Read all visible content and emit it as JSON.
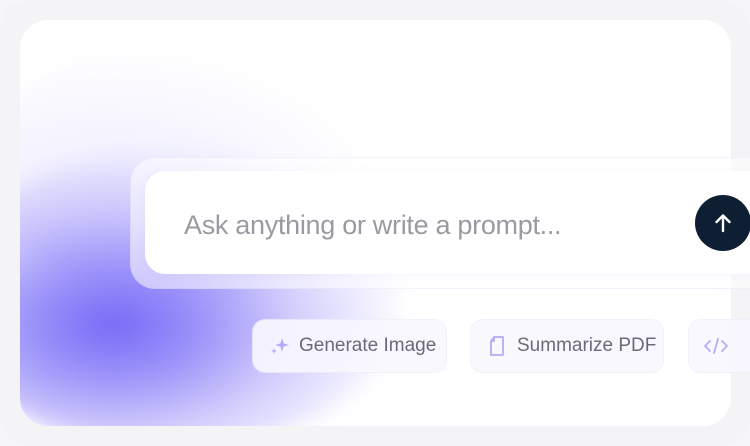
{
  "prompt": {
    "placeholder": "Ask anything or write a prompt..."
  },
  "send": {
    "icon": "arrow-up-icon"
  },
  "suggestions": [
    {
      "label": "Generate Image",
      "icon": "sparkles-icon"
    },
    {
      "label": "Summarize PDF",
      "icon": "document-icon"
    },
    {
      "label": "",
      "icon": "code-icon"
    }
  ],
  "colors": {
    "accent": "#7b6ef6",
    "send_button": "#0f1f33",
    "placeholder_text": "#9a9aa2",
    "chip_text": "#6b6b78",
    "icon_tint": "#b4acf5"
  }
}
